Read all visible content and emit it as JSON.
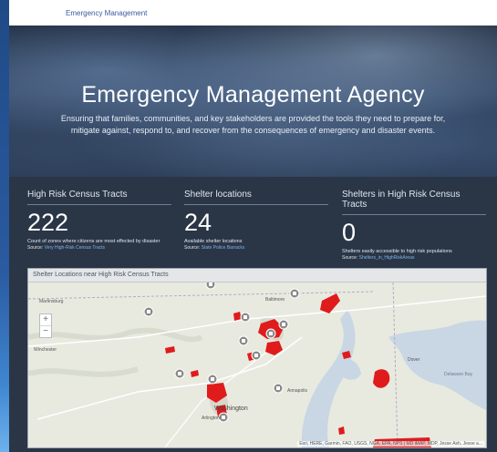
{
  "header": {
    "title": "Emergency Management"
  },
  "hero": {
    "title": "Emergency Management Agency",
    "subtitle": "Ensuring that families, communities, and key stakeholders are provided the tools they need to prepare for, mitigate against, respond to, and recover from the consequences of emergency and disaster events."
  },
  "stats": [
    {
      "title": "High Risk Census Tracts",
      "value": "222",
      "description": "Count of zones where citizens are most effected by disaster",
      "source_label": "Source:",
      "source_link": "Very High-Risk Census Tracts"
    },
    {
      "title": "Shelter locations",
      "value": "24",
      "description": "Available shelter locations",
      "source_label": "Source:",
      "source_link": "State Police Barracks"
    },
    {
      "title": "Shelters in High Risk Census Tracts",
      "value": "0",
      "description": "Shelters easily accessible to high risk populations",
      "source_label": "Source:",
      "source_link": "Shelters_in_HighRiskAreas"
    }
  ],
  "map": {
    "title": "Shelter Locations near High Risk Census Tracts",
    "zoom_in": "+",
    "zoom_out": "−",
    "labels": [
      "Martinsburg",
      "Winchester",
      "Washington",
      "Arlington",
      "Annapolis",
      "Dover",
      "Baltimore",
      "Delaware Bay"
    ],
    "attribution": "Esri, HERE, Garmin, FAO, USGS, NGA, EPA, NPS | MD iMAP, MDP, Jesse Ash, Jesse a..."
  },
  "colors": {
    "accent_link": "#7fb2ee",
    "risk_area": "#e01b1b",
    "shelter_marker": "#8a8a8a",
    "water": "#c9d6e4"
  }
}
